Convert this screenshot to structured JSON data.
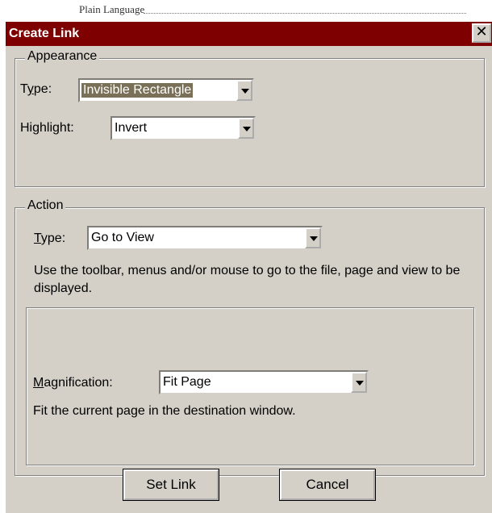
{
  "background": {
    "doc_text": "Plain Language"
  },
  "dialog": {
    "title": "Create Link",
    "close_glyph": "✕"
  },
  "appearance": {
    "group_label": "Appearance",
    "type_label_pre": "T",
    "type_label_u": "y",
    "type_label_post": "pe:",
    "type_value": "Invisible Rectangle",
    "highlight_label_pre": "Hi",
    "highlight_label_u": "g",
    "highlight_label_post": "hlight:",
    "highlight_value": "Invert"
  },
  "action": {
    "group_label": "Action",
    "type_label_u": "T",
    "type_label_post": "ype:",
    "type_value": "Go to View",
    "description": "Use the toolbar, menus and/or mouse to go to the file, page and view to be displayed.",
    "magnification_label_u": "M",
    "magnification_label_post": "agnification:",
    "magnification_value": "Fit Page",
    "magnification_description": "Fit the current page in the destination window."
  },
  "buttons": {
    "set_link": "Set Link",
    "cancel": "Cancel"
  },
  "colors": {
    "titlebar": "#7f0000",
    "dialog_bg": "#d4d0c8",
    "selected_bg": "#7a7058"
  }
}
